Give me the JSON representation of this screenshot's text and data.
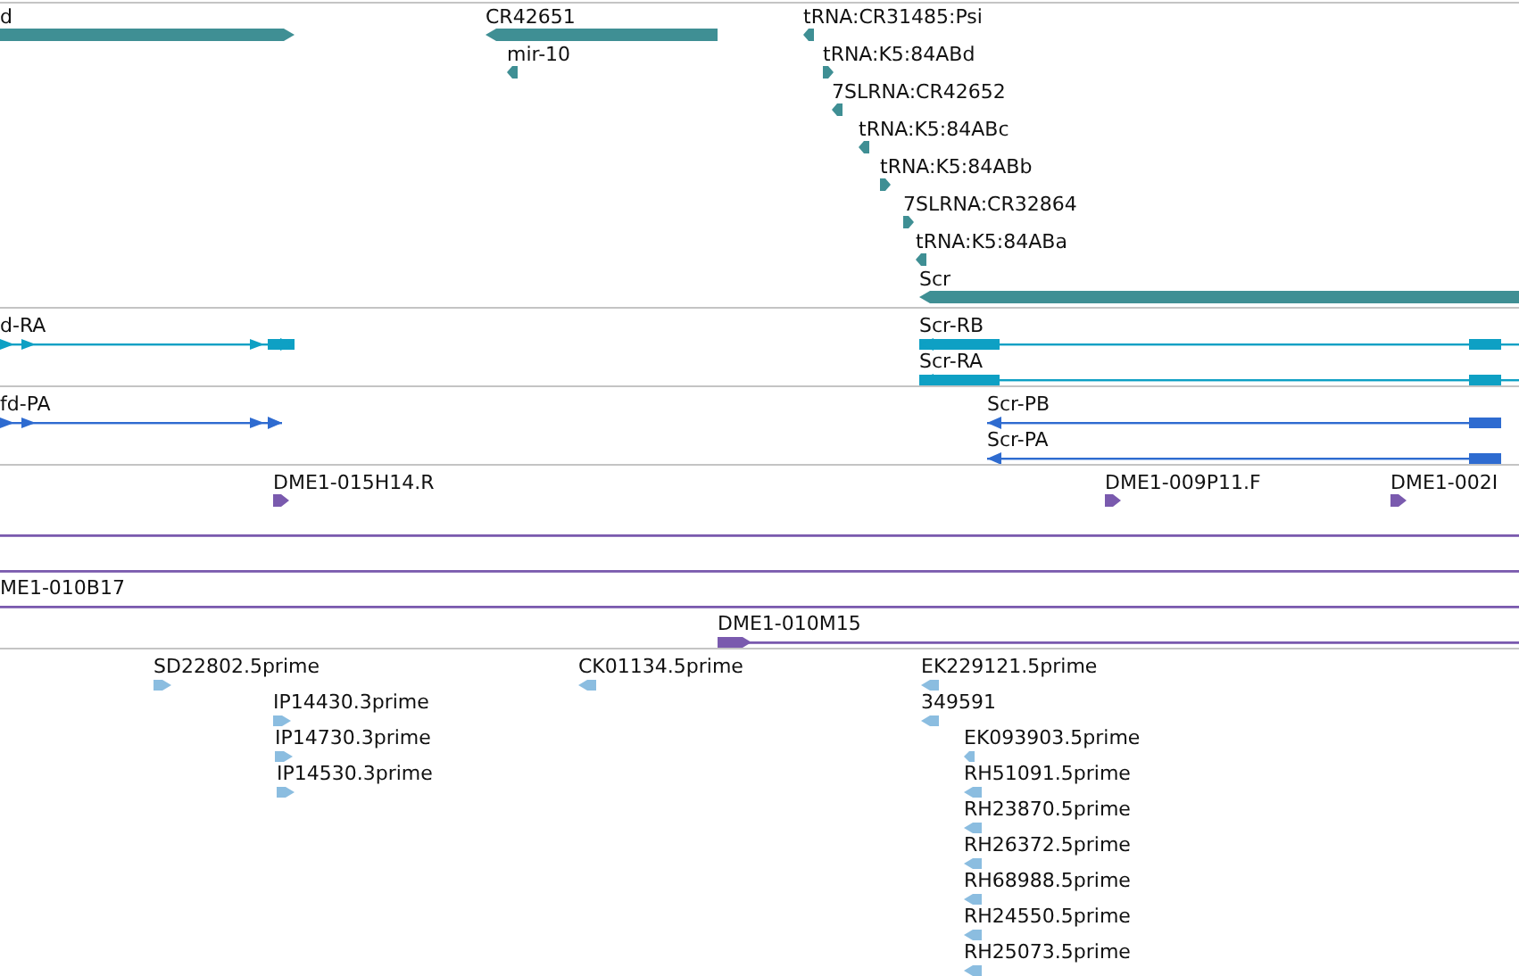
{
  "tracks": [
    {
      "kind": "gene",
      "features": [
        {
          "label": "d",
          "kind": "gene",
          "reverse": false
        },
        {
          "label": "CR42651",
          "kind": "gene",
          "reverse": true
        },
        {
          "label": "mir-10",
          "kind": "marker",
          "reverse": true
        },
        {
          "label": "tRNA:CR31485:Psi",
          "kind": "marker",
          "reverse": true
        },
        {
          "label": "tRNA:K5:84ABd",
          "kind": "marker",
          "reverse": false
        },
        {
          "label": "7SLRNA:CR42652",
          "kind": "marker",
          "reverse": true
        },
        {
          "label": "tRNA:K5:84ABc",
          "kind": "marker",
          "reverse": true
        },
        {
          "label": "tRNA:K5:84ABb",
          "kind": "marker",
          "reverse": false
        },
        {
          "label": "7SLRNA:CR32864",
          "kind": "marker",
          "reverse": false
        },
        {
          "label": "tRNA:K5:84ABa",
          "kind": "marker",
          "reverse": true
        },
        {
          "label": "Scr",
          "kind": "gene",
          "reverse": true
        }
      ]
    },
    {
      "kind": "transcript",
      "features": [
        {
          "label": "d-RA",
          "kind": "transcript",
          "reverse": false
        },
        {
          "label": "Scr-RB",
          "kind": "transcript",
          "reverse": true
        },
        {
          "label": "Scr-RA",
          "kind": "transcript",
          "reverse": true
        }
      ]
    },
    {
      "kind": "protein",
      "features": [
        {
          "label": "fd-PA",
          "kind": "transcript",
          "reverse": false
        },
        {
          "label": "Scr-PB",
          "kind": "transcript",
          "reverse": true
        },
        {
          "label": "Scr-PA",
          "kind": "transcript",
          "reverse": true
        }
      ]
    },
    {
      "kind": "clone",
      "features": [
        {
          "label": "DME1-015H14.R",
          "kind": "marker",
          "reverse": false
        },
        {
          "label": "DME1-009P11.F",
          "kind": "marker",
          "reverse": false
        },
        {
          "label": "DME1-002I",
          "kind": "marker",
          "reverse": false
        },
        {
          "kind": "clone"
        },
        {
          "kind": "clone"
        },
        {
          "label": "ME1-010B17",
          "kind": "clone"
        },
        {
          "label": "DME1-010M15",
          "kind": "clone",
          "reverse": false
        }
      ]
    },
    {
      "kind": "est",
      "features": [
        {
          "label": "SD22802.5prime",
          "kind": "marker",
          "reverse": false
        },
        {
          "label": "IP14430.3prime",
          "kind": "marker",
          "reverse": false
        },
        {
          "label": "IP14730.3prime",
          "kind": "marker",
          "reverse": false
        },
        {
          "label": "IP14530.3prime",
          "kind": "marker",
          "reverse": false
        },
        {
          "label": "CK01134.5prime",
          "kind": "marker",
          "reverse": true
        },
        {
          "label": "EK229121.5prime",
          "kind": "marker",
          "reverse": true
        },
        {
          "label": "349591",
          "kind": "marker",
          "reverse": true
        },
        {
          "label": "EK093903.5prime",
          "kind": "marker",
          "reverse": true
        },
        {
          "label": "RH51091.5prime",
          "kind": "marker",
          "reverse": true
        },
        {
          "label": "RH23870.5prime",
          "kind": "marker",
          "reverse": true
        },
        {
          "label": "RH26372.5prime",
          "kind": "marker",
          "reverse": true
        },
        {
          "label": "RH68988.5prime",
          "kind": "marker",
          "reverse": true
        },
        {
          "label": "RH24550.5prime",
          "kind": "marker",
          "reverse": true
        },
        {
          "label": "RH25073.5prime",
          "kind": "marker",
          "reverse": true
        }
      ]
    }
  ]
}
